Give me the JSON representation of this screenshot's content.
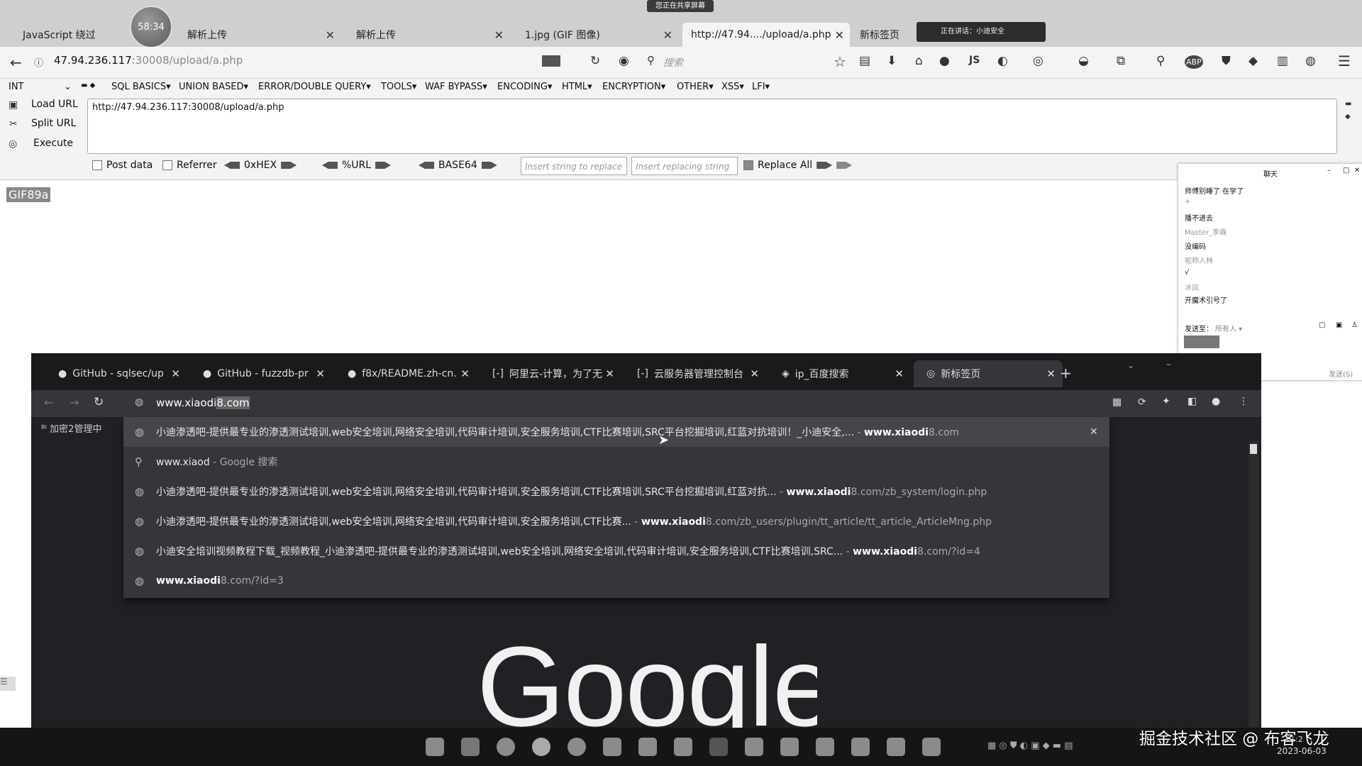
{
  "firefox": {
    "tabs": [
      {
        "title": "JavaScript 绕过"
      },
      {
        "title": "解析上传"
      },
      {
        "title": "解析上传"
      },
      {
        "title": "1.jpg (GIF 图像)"
      },
      {
        "title": "http://47.94..../upload/a.php"
      },
      {
        "title": "新标签页"
      }
    ],
    "timer": "58:34",
    "share_banner": "您正在共享屏幕",
    "share_mini": "正在讲话：小迪安全",
    "url_host": "47.94.236.117",
    "url_rest": ":30008/upload/a.php",
    "search_placeholder": "搜索",
    "icons": {
      "js": "JS",
      "abp": "ABP"
    }
  },
  "hackbar": {
    "select_value": "INT",
    "menus": [
      "SQL BASICS▾",
      "UNION BASED▾",
      "ERROR/DOUBLE QUERY▾",
      "TOOLS▾",
      "WAF BYPASS▾",
      "ENCODING▾",
      "HTML▾",
      "ENCRYPTION▾",
      "OTHER▾",
      "XSS▾",
      "LFI▾"
    ],
    "load_url": "Load URL",
    "split_url": "Split URL",
    "execute": "Execute",
    "url_value": "http://47.94.236.117:30008/upload/a.php",
    "post_data": "Post data",
    "referrer": "Referrer",
    "hex": "0xHEX",
    "url_enc": "%URL",
    "base64": "BASE64",
    "insert_replace_ph": "Insert string to replace",
    "insert_replacing_ph": "Insert replacing string",
    "replace_all": "Replace All"
  },
  "page": {
    "gif_header": "GIF89a"
  },
  "chat": {
    "title": "聊天",
    "lines": [
      "师傅别睡了 在学了",
      "+",
      "播不进去",
      "Master_季霖",
      "没编码",
      "昵称入林",
      "√",
      "冰凤",
      "开魔术引号了"
    ],
    "send_to_label": "发送至：",
    "send_to_value": "所有人 ▾",
    "send_button": "发送(S)"
  },
  "chrome": {
    "tabs": [
      {
        "title": "GitHub - sqlsec/up"
      },
      {
        "title": "GitHub - fuzzdb-pr"
      },
      {
        "title": "f8x/README.zh-cn."
      },
      {
        "title": "阿里云-计算，为了无"
      },
      {
        "title": "云服务器管理控制台"
      },
      {
        "title": "ip_百度搜索"
      },
      {
        "title": "新标签页"
      }
    ],
    "new_tab": "+",
    "omnibox_typed": "www.xiaodi",
    "omnibox_selected": "8.com",
    "bookmark": "加密2管理中",
    "suggestions": [
      {
        "title": "小迪渗透吧-提供最专业的渗透测试培训,web安全培训,网络安全培训,代码审计培训,安全服务培训,CTF比赛培训,SRC平台挖掘培训,红蓝对抗培训！_小迪安全,...",
        "url_bold": "www.xiaodi",
        "url_rest": "8.com",
        "sep": " - "
      },
      {
        "title": "www.xiaod",
        "url_bold": "",
        "url_rest": "Google 搜索",
        "sep": " - "
      },
      {
        "title": "小迪渗透吧-提供最专业的渗透测试培训,web安全培训,网络安全培训,代码审计培训,安全服务培训,CTF比赛培训,SRC平台挖掘培训,红蓝对抗...",
        "url_bold": "www.xiaodi",
        "url_rest": "8.com/zb_system/login.php",
        "sep": " - "
      },
      {
        "title": "小迪渗透吧-提供最专业的渗透测试培训,web安全培训,网络安全培训,代码审计培训,安全服务培训,CTF比赛...",
        "url_bold": "www.xiaodi",
        "url_rest": "8.com/zb_users/plugin/tt_article/tt_article_ArticleMng.php",
        "sep": " - "
      },
      {
        "title": "小迪安全培训视频教程下载_视频教程_小迪渗透吧-提供最专业的渗透测试培训,web安全培训,网络安全培训,代码审计培训,安全服务培训,CTF比赛培训,SRC...",
        "url_bold": "www.xiaodi",
        "url_rest": "8.com/?id=4",
        "sep": " - "
      },
      {
        "title": "",
        "url_bold": "www.xiaodi",
        "url_rest": "8.com/?id=3",
        "sep": ""
      }
    ],
    "logo_text": "Google"
  },
  "taskbar": {
    "watermark": "掘金技术社区 @ 布客飞龙",
    "time": "21:2",
    "date": "2023-06-03"
  }
}
